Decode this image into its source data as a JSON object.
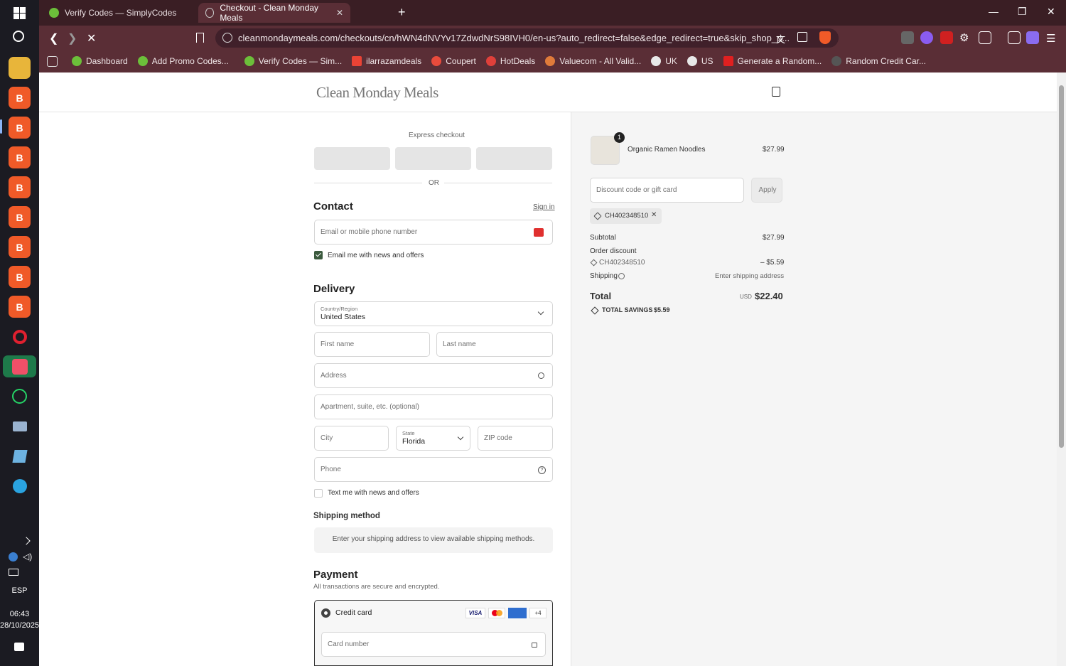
{
  "taskbar": {
    "language": "ESP",
    "time": "06:43",
    "date": "28/10/2025"
  },
  "tabs": [
    {
      "title": "Verify Codes — SimplyCodes"
    },
    {
      "title": "Checkout - Clean Monday Meals"
    }
  ],
  "address_bar": {
    "url": "cleanmondaymeals.com/checkouts/cn/hWN4dNVYv17ZdwdNrS98IVH0/en-us?auto_redirect=false&edge_redirect=true&skip_shop_p..."
  },
  "bookmarks": [
    {
      "label": "Dashboard",
      "color": "#6cbf3a"
    },
    {
      "label": "Add Promo Codes...",
      "color": "#6cbf3a"
    },
    {
      "label": "Verify Codes — Sim...",
      "color": "#6cbf3a"
    },
    {
      "label": "ilarrazamdeals",
      "color": "#ea4335"
    },
    {
      "label": "Coupert",
      "color": "#e84b3c"
    },
    {
      "label": "HotDeals",
      "color": "#e0403a"
    },
    {
      "label": "Valuecom - All Valid...",
      "color": "#e07b3a"
    },
    {
      "label": "UK",
      "color": "#e8e8e8"
    },
    {
      "label": "US",
      "color": "#e8e8e8"
    },
    {
      "label": "Generate a Random...",
      "color": "#e02020"
    },
    {
      "label": "Random Credit Car...",
      "color": "#555555"
    }
  ],
  "page": {
    "logo": "Clean Monday Meals",
    "express_checkout": "Express checkout",
    "or": "OR",
    "contact": {
      "title": "Contact",
      "sign_in": "Sign in",
      "email_placeholder": "Email or mobile phone number",
      "news_label": "Email me with news and offers"
    },
    "delivery": {
      "title": "Delivery",
      "country_label": "Country/Region",
      "country_value": "United States",
      "first_name": "First name",
      "last_name": "Last name",
      "address": "Address",
      "apartment": "Apartment, suite, etc. (optional)",
      "city": "City",
      "state_label": "State",
      "state_value": "Florida",
      "zip": "ZIP code",
      "phone": "Phone",
      "text_label": "Text me with news and offers"
    },
    "shipping": {
      "title": "Shipping method",
      "message": "Enter your shipping address to view available shipping methods."
    },
    "payment": {
      "title": "Payment",
      "subtitle": "All transactions are secure and encrypted.",
      "credit_card": "Credit card",
      "visa": "VISA",
      "more_cards": "+4",
      "card_number": "Card number"
    }
  },
  "summary": {
    "item_name": "Organic Ramen Noodles",
    "item_qty": "1",
    "item_price": "$27.99",
    "discount_placeholder": "Discount code or gift card",
    "apply": "Apply",
    "code": "CH402348510",
    "subtotal_label": "Subtotal",
    "subtotal": "$27.99",
    "order_discount": "Order discount",
    "discount_code": "CH402348510",
    "discount_amount": "– $5.59",
    "shipping_label": "Shipping",
    "shipping_value": "Enter shipping address",
    "total_label": "Total",
    "currency": "USD",
    "total": "$22.40",
    "savings_label": "TOTAL SAVINGS",
    "savings": "$5.59"
  }
}
